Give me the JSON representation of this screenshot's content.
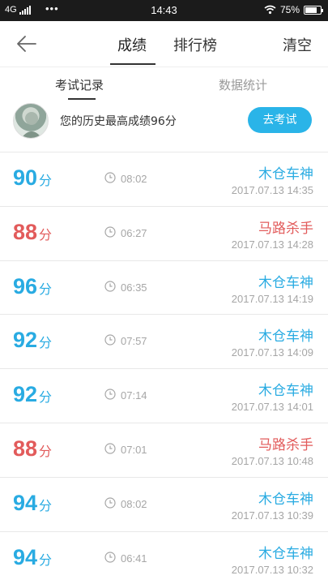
{
  "colors": {
    "accent": "#29abe2",
    "warn": "#e25b5b",
    "muted": "#a6a6a6",
    "button": "#2ab4e8"
  },
  "statusbar": {
    "network": "4G",
    "dots": "•••",
    "time": "14:43",
    "battery": "75%",
    "battery_level": 0.75
  },
  "navbar": {
    "back_icon": "arrow-left-icon",
    "tabs": [
      {
        "label": "成绩"
      },
      {
        "label": "排行榜"
      }
    ],
    "clear_label": "清空"
  },
  "subtabs": [
    {
      "label": "考试记录"
    },
    {
      "label": "数据统计"
    }
  ],
  "best": {
    "text": "您的历史最高成绩96分",
    "button": "去考试"
  },
  "records": [
    {
      "score": "90",
      "unit": "分",
      "duration": "08:02",
      "title": "木仓车神",
      "datetime": "2017.07.13  14:35",
      "tone": "blue"
    },
    {
      "score": "88",
      "unit": "分",
      "duration": "06:27",
      "title": "马路杀手",
      "datetime": "2017.07.13  14:28",
      "tone": "red"
    },
    {
      "score": "96",
      "unit": "分",
      "duration": "06:35",
      "title": "木仓车神",
      "datetime": "2017.07.13  14:19",
      "tone": "blue"
    },
    {
      "score": "92",
      "unit": "分",
      "duration": "07:57",
      "title": "木仓车神",
      "datetime": "2017.07.13  14:09",
      "tone": "blue"
    },
    {
      "score": "92",
      "unit": "分",
      "duration": "07:14",
      "title": "木仓车神",
      "datetime": "2017.07.13  14:01",
      "tone": "blue"
    },
    {
      "score": "88",
      "unit": "分",
      "duration": "07:01",
      "title": "马路杀手",
      "datetime": "2017.07.13  10:48",
      "tone": "red"
    },
    {
      "score": "94",
      "unit": "分",
      "duration": "08:02",
      "title": "木仓车神",
      "datetime": "2017.07.13  10:39",
      "tone": "blue"
    },
    {
      "score": "94",
      "unit": "分",
      "duration": "06:41",
      "title": "木仓车神",
      "datetime": "2017.07.13  10:32",
      "tone": "blue"
    }
  ]
}
